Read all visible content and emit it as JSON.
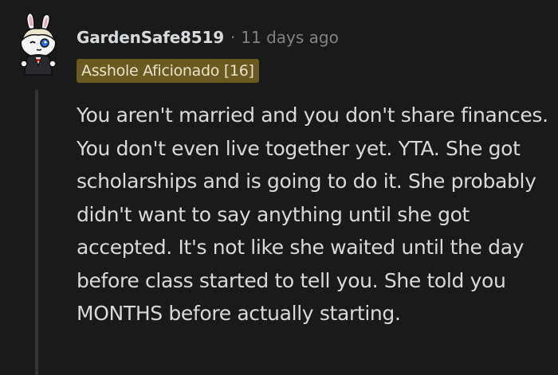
{
  "comment": {
    "author": "GardenSafe8519",
    "separator": "·",
    "timestamp": "11 days ago",
    "flair": "Asshole Aficionado [16]",
    "body": "You aren't married and you don't share finances. You don't even live together yet. YTA. She got scholarships and is going to do it. She probably didn't want to say anything until she got accepted. It's not like she waited until the day before class started to tell you. She told you MONTHS before actually starting."
  },
  "colors": {
    "background": "#1a1a1b",
    "text": "#d7dadc",
    "meta": "#818384",
    "flair_bg": "#6b5a1f",
    "thread_line": "#343536"
  },
  "icons": {
    "avatar": "snoo-avatar-bunny-ears-icon"
  }
}
